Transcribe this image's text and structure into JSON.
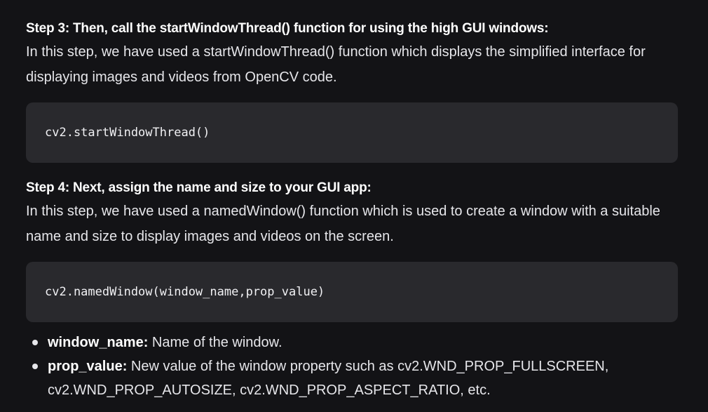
{
  "step3": {
    "title": "Step 3: Then, call the startWindowThread() function for using the high GUI windows:",
    "body": "In this step, we have used a startWindowThread() function which displays the simplified interface for displaying images and videos from OpenCV code.",
    "code": "cv2.startWindowThread()"
  },
  "step4": {
    "title": "Step 4: Next, assign the name and size to your GUI app:",
    "body": "In this step, we have used a namedWindow() function which is used to create a window with a suitable name and size to display images and videos on the screen.",
    "code": "cv2.namedWindow(window_name,prop_value)"
  },
  "params": [
    {
      "term": "window_name:",
      "desc": " Name of the window."
    },
    {
      "term": "prop_value:",
      "desc": " New value of the window property such as cv2.WND_PROP_FULLSCREEN, cv2.WND_PROP_AUTOSIZE, cv2.WND_PROP_ASPECT_RATIO, etc."
    }
  ]
}
